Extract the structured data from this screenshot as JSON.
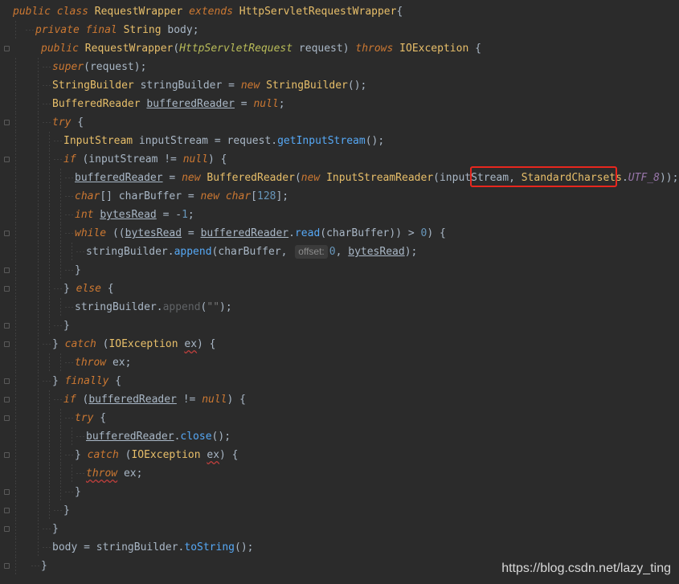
{
  "editor": {
    "lines": [
      [
        "public class RequestWrapper extends HttpServletRequestWrapper{"
      ],
      [
        "private final String body;"
      ],
      [
        "public RequestWrapper(HttpServletRequest request) throws IOException {"
      ],
      [
        "super(request);"
      ],
      [
        "StringBuilder stringBuilder = new StringBuilder();"
      ],
      [
        "BufferedReader bufferedReader = null;"
      ],
      [
        "try {"
      ],
      [
        "InputStream inputStream = request.getInputStream();"
      ],
      [
        "if (inputStream != null) {"
      ],
      [
        "bufferedReader = new BufferedReader(new InputStreamReader(inputStream, StandardCharsets.UTF_8));"
      ],
      [
        "char[] charBuffer = new char[128];"
      ],
      [
        "int bytesRead = -1;"
      ],
      [
        "while ((bytesRead = bufferedReader.read(charBuffer)) > 0) {"
      ],
      [
        "stringBuilder.append(charBuffer, offset: 0, bytesRead);"
      ],
      [
        "}"
      ],
      [
        "} else {"
      ],
      [
        "stringBuilder.append(\"\");"
      ],
      [
        "}"
      ],
      [
        "} catch (IOException ex) {"
      ],
      [
        "throw ex;"
      ],
      [
        "} finally {"
      ],
      [
        "if (bufferedReader != null) {"
      ],
      [
        "try {"
      ],
      [
        "bufferedReader.close();"
      ],
      [
        "} catch (IOException ex) {"
      ],
      [
        "throw ex;"
      ],
      [
        "}"
      ],
      [
        "}"
      ],
      [
        "}"
      ],
      [
        "body = stringBuilder.toString();"
      ],
      [
        "}"
      ]
    ],
    "param_hint": "offset:",
    "watermark": "https://blog.csdn.net/lazy_ting"
  },
  "colors": {
    "background": "#2b2b2b",
    "keyword": "#cc7832",
    "class": "#e8bf6a",
    "method": "#56a8f5",
    "number": "#6897bb",
    "highlight_box": "#e8271e"
  }
}
